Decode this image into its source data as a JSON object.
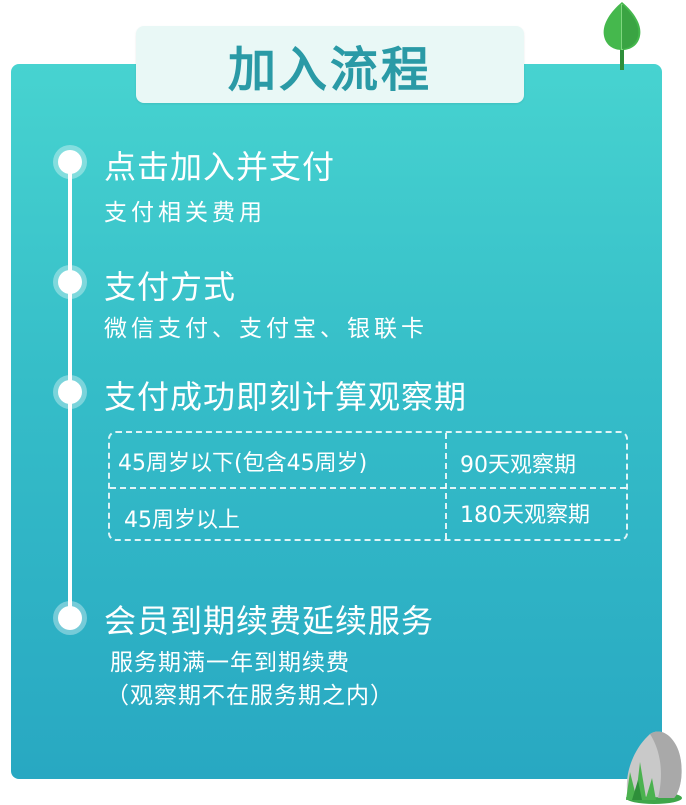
{
  "title": "加入流程",
  "steps": [
    {
      "title": "点击加入并支付",
      "sub": "支付相关费用"
    },
    {
      "title": "支付方式",
      "sub": "微信支付、支付宝、银联卡"
    },
    {
      "title": "支付成功即刻计算观察期"
    },
    {
      "title": "会员到期续费延续服务",
      "sub1": "服务期满一年到期续费",
      "sub2": "（观察期不在服务期之内）"
    }
  ],
  "table": {
    "rows": [
      {
        "age": "45周岁以下(包含45周岁)",
        "period": "90天观察期"
      },
      {
        "age": "45周岁以上",
        "period": "180天观察期"
      }
    ]
  },
  "colors": {
    "accent_top": "#47d3d0",
    "accent_bottom": "#28a8c2",
    "title_text": "#2a9aa6",
    "leaf": "#3fb64a"
  }
}
